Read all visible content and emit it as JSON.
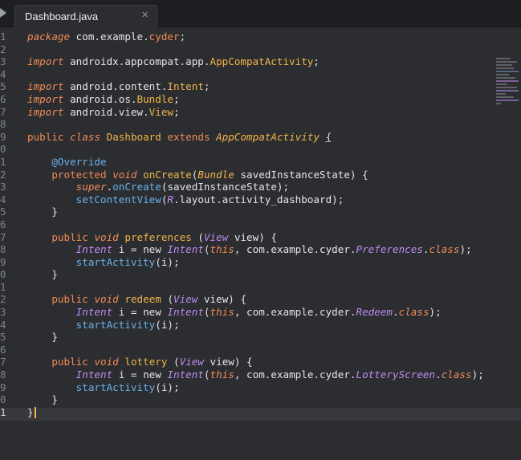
{
  "tab": {
    "title": "Dashboard.java",
    "close_glyph": "×"
  },
  "gutter": {
    "line_numbers": [
      "1",
      "2",
      "3",
      "4",
      "5",
      "6",
      "7",
      "8",
      "9",
      "0",
      "1",
      "2",
      "3",
      "4",
      "5",
      "6",
      "7",
      "8",
      "9",
      "0",
      "1",
      "2",
      "3",
      "4",
      "5",
      "6",
      "7",
      "8",
      "9",
      "0",
      "1"
    ],
    "active_index": 30
  },
  "code": {
    "l1": [
      "package",
      " com.example.",
      "cyder",
      ";"
    ],
    "l3": [
      "import",
      " androidx.appcompat.app.",
      "AppCompatActivity",
      ";"
    ],
    "l5": [
      "import",
      " android.content.",
      "Intent",
      ";"
    ],
    "l6": [
      "import",
      " android.os.",
      "Bundle",
      ";"
    ],
    "l7": [
      "import",
      " android.view.",
      "View",
      ";"
    ],
    "l9": [
      "public",
      " ",
      "class",
      " ",
      "Dashboard",
      " ",
      "extends",
      " ",
      "AppCompatActivity",
      " ",
      "{"
    ],
    "l11": [
      "@Override"
    ],
    "l12": [
      "protected",
      " ",
      "void",
      " ",
      "onCreate",
      "(",
      "Bundle",
      " savedInstanceState) {"
    ],
    "l13": [
      "super",
      ".",
      "onCreate",
      "(savedInstanceState);"
    ],
    "l14": [
      "setContentView",
      "(",
      "R",
      ".layout.activity_dashboard);"
    ],
    "l15": [
      "}"
    ],
    "l17": [
      "public",
      " ",
      "void",
      " ",
      "preferences",
      " (",
      "View",
      " view) {"
    ],
    "l18": [
      "Intent",
      " i = new ",
      "Intent",
      "(",
      "this",
      ", com.example.cyder.",
      "Preferences",
      ".",
      "class",
      ");"
    ],
    "l19": [
      "startActivity",
      "(i);"
    ],
    "l20": [
      "}"
    ],
    "l22": [
      "public",
      " ",
      "void",
      " ",
      "redeem",
      " (",
      "View",
      " view) {"
    ],
    "l23": [
      "Intent",
      " i = new ",
      "Intent",
      "(",
      "this",
      ", com.example.cyder.",
      "Redeem",
      ".",
      "class",
      ");"
    ],
    "l24": [
      "startActivity",
      "(i);"
    ],
    "l25": [
      "}"
    ],
    "l27": [
      "public",
      " ",
      "void",
      " ",
      "lottery",
      " (",
      "View",
      " view) {"
    ],
    "l28": [
      "Intent",
      " i = new ",
      "Intent",
      "(",
      "this",
      ", com.example.cyder.",
      "LotteryScreen",
      ".",
      "class",
      ");"
    ],
    "l29": [
      "startActivity",
      "(i);"
    ],
    "l30": [
      "}"
    ],
    "l31": [
      "}"
    ]
  },
  "colors": {
    "background": "#2b2d31",
    "keyword": "#f28b54",
    "type": "#f3b547",
    "function": "#6ab0e6",
    "italic_class": "#c08cf0"
  }
}
